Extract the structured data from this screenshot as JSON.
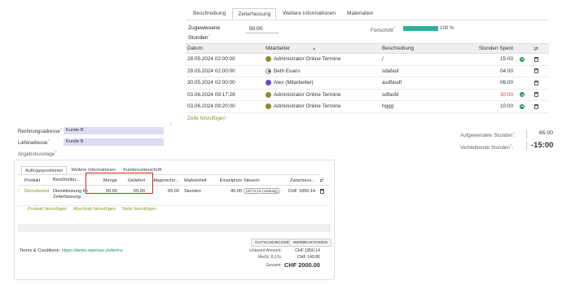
{
  "timesheet": {
    "tabs": [
      {
        "label": "Beschreibung"
      },
      {
        "label": "Zeiterfassung"
      },
      {
        "label": "Weitere Informationen"
      },
      {
        "label": "Materialien"
      }
    ],
    "allocated_label": "Zugewiesene Stunden",
    "allocated_value": "50:00",
    "progress_label": "Fortschritt",
    "progress_percent": 100,
    "progress_text": "100 %",
    "progress_color": "#2bb39a",
    "columns": {
      "date": "Datum",
      "employee": "Mitarbeiter",
      "description": "Beschreibung",
      "hours": "Stunden Spent"
    },
    "rows": [
      {
        "date": "28.05.2024 02:00:00",
        "employee": "Administrator Online Termine",
        "description": "/",
        "hours": "15:00"
      },
      {
        "date": "29.05.2024 02:00:00",
        "employee": "Beth Evans",
        "description": "sdafasf",
        "hours": "04:00"
      },
      {
        "date": "30.05.2024 02:00:00",
        "employee": "Alex (Mitarbeiter)",
        "description": "asdfasdf",
        "hours": "06:00"
      },
      {
        "date": "03.06.2024 09:17:28",
        "employee": "Administrator Online Termine",
        "description": "sdfasfd",
        "hours": "30:00"
      },
      {
        "date": "03.06.2024 09:20:00",
        "employee": "Administrator Online Termine",
        "description": "hggg",
        "hours": "10:00"
      }
    ],
    "add_line": "Zeile hinzufügen",
    "spent_label": "Aufgewendete Stunden",
    "spent_value": "65:00",
    "remaining_label": "Verbleibende Stunden",
    "remaining_value": "-15:00"
  },
  "offer": {
    "billing_label": "Rechnungsadresse",
    "billing_value": "Kunde B",
    "delivery_label": "Lieferadresse",
    "delivery_value": "Kunde B",
    "template_label": "Angebotsvorlage",
    "tabs": [
      {
        "label": "Auftragspositionen"
      },
      {
        "label": "Weitere Informationen"
      },
      {
        "label": "Kundenunterschrift"
      }
    ],
    "columns": {
      "product": "Produkt",
      "description": "Beschreibu...",
      "quantity": "Menge",
      "delivered": "Geliefert",
      "ordered": "Abgerechn...",
      "unit": "Maßeinheit",
      "price": "Einzelpreis",
      "tax": "Steuern",
      "subtotal": "Zwischens..."
    },
    "line": {
      "product": "Dienstleistung für Zeiterfassung",
      "description": "Dienstleistung für Zeiterfassung",
      "quantity": "50.00",
      "delivered": "65.00",
      "ordered": "65.00",
      "unit": "Stunden",
      "price": "40.00",
      "tax": "UST 8,1% (Leistung)",
      "subtotal": "CHF 1850.14"
    },
    "links": {
      "add_product": "Produkt hinzufügen",
      "add_section": "Abschnitt hinzufügen",
      "add_note": "Notiz hinzufügen"
    },
    "terms_label": "Terms & Conditions:",
    "terms_url": "https://demo.opentaz.ch/terms",
    "buttons": {
      "coupon": "GUTSCHEINCODE",
      "promotions": "WERBEAKTIONEN"
    },
    "totals": {
      "untaxed_label": "Untaxed Amount:",
      "untaxed_value": "CHF 1850.14",
      "vat_label": "MwSt. 8,1%:",
      "vat_value": "CHF 149.86",
      "total_label": "Gesamt:",
      "total_value": "CHF 2000.00"
    }
  }
}
